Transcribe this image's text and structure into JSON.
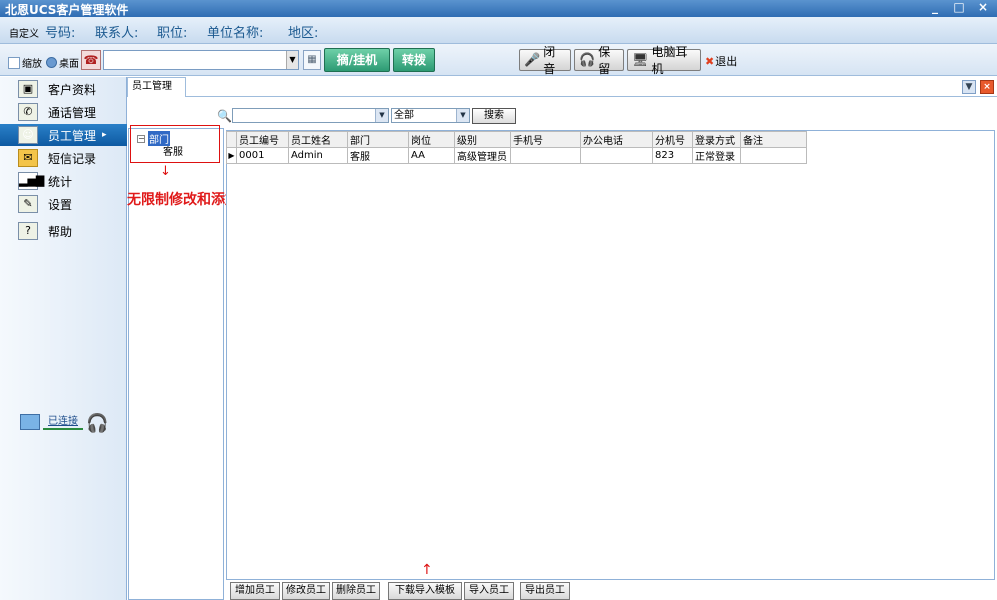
{
  "window": {
    "title": "北恩UCS客户管理软件",
    "min": "_",
    "max": "□",
    "close": "×"
  },
  "infobar": {
    "custom": "自定义",
    "fields": [
      "号码:",
      "联系人:",
      "职位:",
      "单位名称:",
      "地区:"
    ]
  },
  "toolbar": {
    "shrink_label": "缩放",
    "desktop_label": "桌面",
    "phone_value": "",
    "answer_hangup": "摘/挂机",
    "transfer": "转拨",
    "mute": "闭音",
    "hold": "保留",
    "pc_headset": "电脑耳机",
    "exit": "退出"
  },
  "sidebar": {
    "items": [
      {
        "label": "客户资料",
        "icon": "contacts-icon"
      },
      {
        "label": "通话管理",
        "icon": "call-icon"
      },
      {
        "label": "员工管理",
        "icon": "staff-icon"
      },
      {
        "label": "短信记录",
        "icon": "envelope-icon"
      },
      {
        "label": "统计",
        "icon": "bar-chart-icon"
      },
      {
        "label": "设置",
        "icon": "settings-icon"
      },
      {
        "label": "帮助",
        "icon": "help-icon"
      }
    ],
    "active_index": 2,
    "status": "已连接"
  },
  "tab": {
    "label": "员工管理"
  },
  "search": {
    "keyword": "",
    "scope": "全部",
    "button": "搜索"
  },
  "tree": {
    "root": "部门",
    "children": [
      "客服"
    ],
    "note": "无限制修改和添加"
  },
  "grid": {
    "columns": [
      "员工编号",
      "员工姓名",
      "部门",
      "岗位",
      "级别",
      "手机号",
      "办公电话",
      "分机号",
      "登录方式",
      "备注"
    ],
    "rows": [
      [
        "0001",
        "Admin",
        "客服",
        "AA",
        "高级管理员",
        "",
        "",
        "823",
        "正常登录",
        ""
      ]
    ]
  },
  "actions": {
    "add": "增加员工",
    "edit": "修改员工",
    "delete": "删除员工",
    "download_template": "下载导入模板",
    "import": "导入员工",
    "export": "导出员工"
  }
}
